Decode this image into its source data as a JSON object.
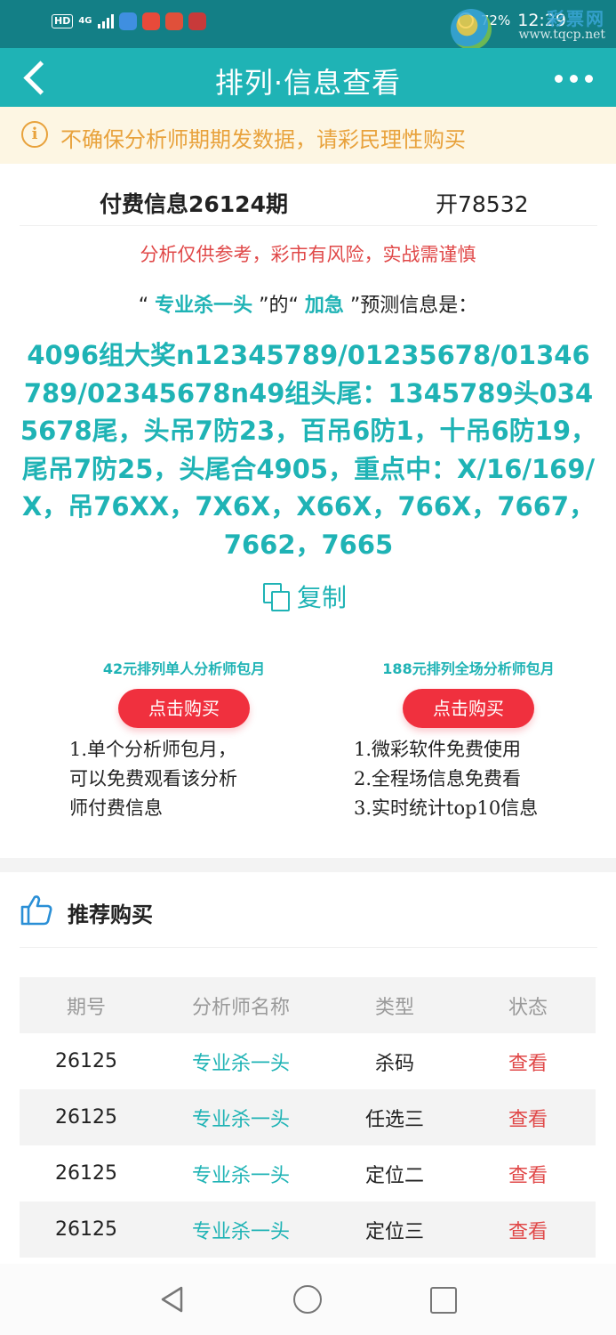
{
  "status_bar": {
    "hd": "HD",
    "network": "4G",
    "time": "12:29",
    "battery": "72%",
    "watermark_cn": "彩票网",
    "watermark_url": "www.tqcp.net",
    "app_colors": [
      "#3f8fe0",
      "#e84a3a",
      "#e0503a",
      "#c83a3a"
    ]
  },
  "header": {
    "title": "排列·信息查看"
  },
  "notice": {
    "icon_char": "i",
    "text": "不确保分析师期期发数据，请彩民理性购买"
  },
  "info": {
    "title": "付费信息26124期",
    "open": "开78532",
    "risk": "分析仅供参考，彩市有风险，实战需谨慎",
    "label_prefix": "“ ",
    "analyst": "专业杀一头",
    "label_mid": " ”的“ ",
    "tag": "加急",
    "label_suffix": " ”预测信息是：",
    "content": "4096组大奖n12345789/01235678/01346789/02345678n49组头尾：1345789头0345678尾，头吊7防23，百吊6防1，十吊6防19，尾吊7防25，头尾合4905，重点中：X/16/169/X，吊76XX，7X6X，X66X，766X，7667，7662，7665"
  },
  "copy": {
    "label": "复制"
  },
  "packages": [
    {
      "title": "42元排列单人分析师包月",
      "button": "点击购买",
      "desc": [
        "1.单个分析师包月，",
        "可以免费观看该分析",
        "师付费信息"
      ]
    },
    {
      "title": "188元排列全场分析师包月",
      "button": "点击购买",
      "desc": [
        "1.微彩软件免费使用",
        "2.全程场信息免费看",
        "3.实时统计top10信息"
      ]
    }
  ],
  "recommend": {
    "title": "推荐购买",
    "columns": [
      "期号",
      "分析师名称",
      "类型",
      "状态"
    ],
    "rows": [
      {
        "issue": "26125",
        "analyst": "专业杀一头",
        "type": "杀码",
        "status": "查看"
      },
      {
        "issue": "26125",
        "analyst": "专业杀一头",
        "type": "任选三",
        "status": "查看"
      },
      {
        "issue": "26125",
        "analyst": "专业杀一头",
        "type": "定位二",
        "status": "查看"
      },
      {
        "issue": "26125",
        "analyst": "专业杀一头",
        "type": "定位三",
        "status": "查看"
      }
    ]
  },
  "colors": {
    "primary": "#1fb3b5",
    "status_bar": "#137f86",
    "warning": "#e8a23c",
    "danger": "#e04848",
    "button": "#f0303e"
  }
}
